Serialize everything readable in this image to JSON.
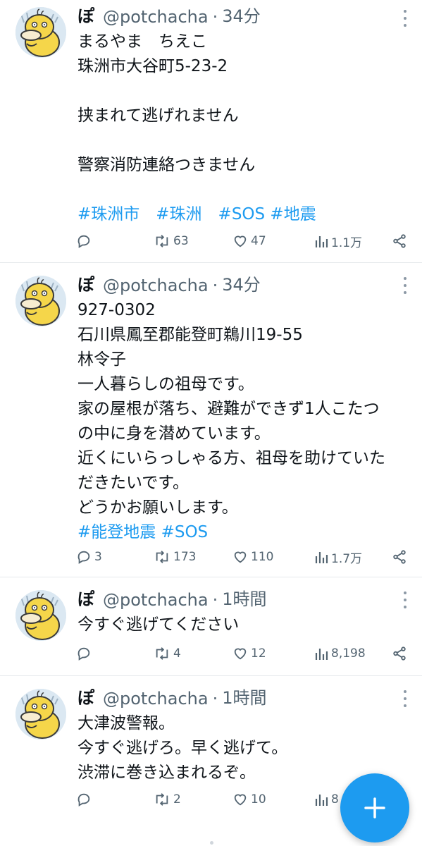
{
  "colors": {
    "link": "#1d9bf0",
    "muted": "#536471",
    "fab": "#1d9bf0"
  },
  "tweets": [
    {
      "name": "ぽ",
      "handle": "@potchacha",
      "separator": "·",
      "time": "34分",
      "lines": [
        "まるやま　ちえこ",
        "珠洲市大谷町5-23-2",
        "",
        "挟まれて逃げれません",
        "",
        "警察消防連絡つきません",
        ""
      ],
      "hashtags": "#珠洲市　#珠洲　#SOS #地震",
      "replies": "",
      "retweets": "63",
      "likes": "47",
      "views": "1.1万"
    },
    {
      "name": "ぽ",
      "handle": "@potchacha",
      "separator": "·",
      "time": "34分",
      "lines": [
        "927-0302",
        "石川県鳳至郡能登町鵜川19-55",
        "林令子",
        "一人暮らしの祖母です。",
        "家の屋根が落ち、避難ができず1人こたつ",
        "の中に身を潜めています。",
        "近くにいらっしゃる方、祖母を助けていた",
        "だきたいです。",
        "どうかお願いします。"
      ],
      "hashtags": "#能登地震 #SOS",
      "replies": "3",
      "retweets": "173",
      "likes": "110",
      "views": "1.7万"
    },
    {
      "name": "ぽ",
      "handle": "@potchacha",
      "separator": "·",
      "time": "1時間",
      "lines": [
        "今すぐ逃げてください"
      ],
      "hashtags": "",
      "replies": "",
      "retweets": "4",
      "likes": "12",
      "views": "8,198"
    },
    {
      "name": "ぽ",
      "handle": "@potchacha",
      "separator": "·",
      "time": "1時間",
      "lines": [
        "大津波警報。",
        "今すぐ逃げろ。早く逃げて。",
        "渋滞に巻き込まれるぞ。"
      ],
      "hashtags": "",
      "replies": "",
      "retweets": "2",
      "likes": "10",
      "views": "8"
    }
  ],
  "icons": {
    "reply": "reply-icon",
    "retweet": "retweet-icon",
    "like": "heart-icon",
    "views": "views-icon",
    "share": "share-icon",
    "compose": "plus-icon",
    "more": "more-icon"
  }
}
